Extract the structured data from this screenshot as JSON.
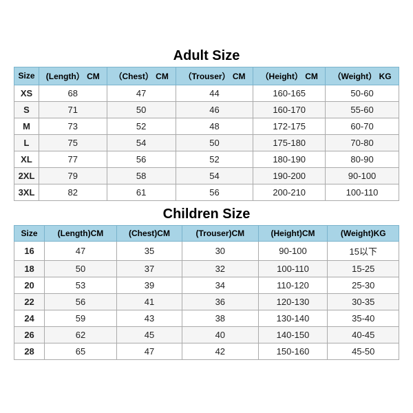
{
  "adult": {
    "title": "Adult Size",
    "headers": [
      "Size",
      "(Length） CM",
      "（Chest） CM",
      "（Trouser） CM",
      "（Height） CM",
      "（Weight） KG"
    ],
    "rows": [
      [
        "XS",
        "68",
        "47",
        "44",
        "160-165",
        "50-60"
      ],
      [
        "S",
        "71",
        "50",
        "46",
        "160-170",
        "55-60"
      ],
      [
        "M",
        "73",
        "52",
        "48",
        "172-175",
        "60-70"
      ],
      [
        "L",
        "75",
        "54",
        "50",
        "175-180",
        "70-80"
      ],
      [
        "XL",
        "77",
        "56",
        "52",
        "180-190",
        "80-90"
      ],
      [
        "2XL",
        "79",
        "58",
        "54",
        "190-200",
        "90-100"
      ],
      [
        "3XL",
        "82",
        "61",
        "56",
        "200-210",
        "100-110"
      ]
    ]
  },
  "children": {
    "title": "Children Size",
    "headers": [
      "Size",
      "(Length)CM",
      "(Chest)CM",
      "(Trouser)CM",
      "(Height)CM",
      "(Weight)KG"
    ],
    "rows": [
      [
        "16",
        "47",
        "35",
        "30",
        "90-100",
        "15以下"
      ],
      [
        "18",
        "50",
        "37",
        "32",
        "100-110",
        "15-25"
      ],
      [
        "20",
        "53",
        "39",
        "34",
        "110-120",
        "25-30"
      ],
      [
        "22",
        "56",
        "41",
        "36",
        "120-130",
        "30-35"
      ],
      [
        "24",
        "59",
        "43",
        "38",
        "130-140",
        "35-40"
      ],
      [
        "26",
        "62",
        "45",
        "40",
        "140-150",
        "40-45"
      ],
      [
        "28",
        "65",
        "47",
        "42",
        "150-160",
        "45-50"
      ]
    ]
  }
}
